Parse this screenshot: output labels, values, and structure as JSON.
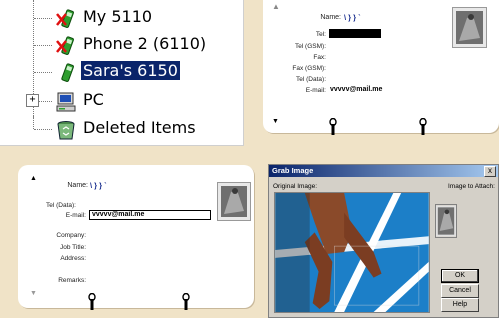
{
  "tree": {
    "items": [
      {
        "label": "My 5110",
        "icon": "phone-disconnected-icon"
      },
      {
        "label": "Phone 2 (6110)",
        "icon": "phone-disconnected-icon"
      },
      {
        "label": "Sara's 6150",
        "icon": "phone-icon"
      },
      {
        "label": "PC",
        "icon": "computer-icon"
      },
      {
        "label": "Deleted Items",
        "icon": "recycle-bin-icon"
      }
    ],
    "expander": "+"
  },
  "card1": {
    "name_label": "Name:",
    "name_value": "\\ } } `",
    "fields": [
      {
        "label": "Tel:",
        "value": ""
      },
      {
        "label": "Tel (GSM):",
        "value": ""
      },
      {
        "label": "Fax:",
        "value": ""
      },
      {
        "label": "Fax (GSM):",
        "value": ""
      },
      {
        "label": "Tel (Data):",
        "value": ""
      },
      {
        "label": "E-mail:",
        "value": "vvvvv@mail.me"
      }
    ]
  },
  "card2": {
    "name_label": "Name:",
    "name_value": "\\ } } `",
    "fields": [
      {
        "label": "Tel (Data):",
        "value": ""
      },
      {
        "label": "E-mail:",
        "value": "vvvvv@mail.me"
      },
      {
        "label": "Company:",
        "value": ""
      },
      {
        "label": "Job Title:",
        "value": ""
      },
      {
        "label": "Address:",
        "value": ""
      },
      {
        "label": "Remarks:",
        "value": ""
      }
    ]
  },
  "grab": {
    "title": "Grab Image",
    "close": "x",
    "original_label": "Original Image:",
    "attach_label": "Image to Attach:",
    "ok": "OK",
    "cancel": "Cancel",
    "help": "Help"
  },
  "colors": {
    "selection": "#0a246a",
    "background": "#f0e3c7",
    "track_blue": "#1c7fc8"
  }
}
